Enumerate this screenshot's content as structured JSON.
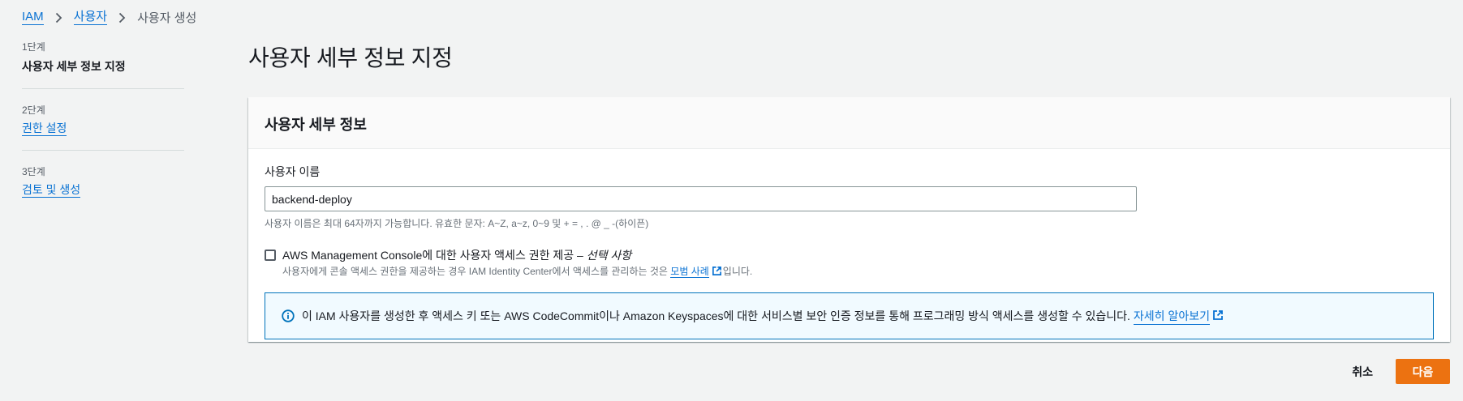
{
  "breadcrumb": {
    "items": [
      "IAM",
      "사용자"
    ],
    "current": "사용자 생성"
  },
  "steps": [
    {
      "num": "1단계",
      "label": "사용자 세부 정보 지정"
    },
    {
      "num": "2단계",
      "label": "권한 설정"
    },
    {
      "num": "3단계",
      "label": "검토 및 생성"
    }
  ],
  "page": {
    "title": "사용자 세부 정보 지정"
  },
  "container": {
    "header": "사용자 세부 정보",
    "username_label": "사용자 이름",
    "username_value": "backend-deploy",
    "username_constraint": "사용자 이름은 최대 64자까지 가능합니다. 유효한 문자: A~Z, a~z, 0~9 및 + = , . @ _ -(하이픈)",
    "console_access": {
      "label_main": "AWS Management Console에 대한 사용자 액세스 권한 제공 – ",
      "label_optional": "선택 사항",
      "desc_before": "사용자에게 콘솔 액세스 권한을 제공하는 경우 IAM Identity Center에서 액세스를 관리하는 것은 ",
      "desc_link": "모범 사례",
      "desc_after": "입니다.",
      "checked": false
    },
    "info": {
      "text": "이 IAM 사용자를 생성한 후 액세스 키 또는 AWS CodeCommit이나 Amazon Keyspaces에 대한 서비스별 보안 인증 정보를 통해 프로그래밍 방식 액세스를 생성할 수 있습니다.",
      "link": "자세히 알아보기"
    }
  },
  "footer": {
    "cancel": "취소",
    "next": "다음"
  },
  "colors": {
    "primary_button": "#ec7211",
    "link": "#0972d3",
    "info_border": "#0073bb"
  }
}
